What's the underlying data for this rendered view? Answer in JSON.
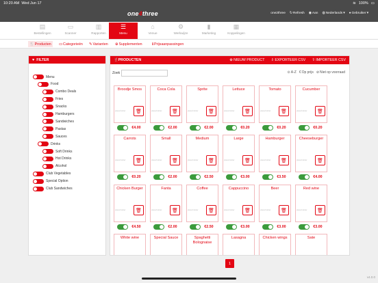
{
  "status": {
    "time": "10:20 AM",
    "date": "Wed Jun 17",
    "battery": "100%"
  },
  "brand": {
    "logo_left": "one",
    "logo_mid": "4",
    "logo_right": "three"
  },
  "header": {
    "user": "one2three",
    "refresh": "Refresh",
    "aan": "Aan",
    "language": "Nederlands",
    "account": "Gebruiker"
  },
  "nav": [
    {
      "label": "Bestellingen",
      "icon": "orders-icon",
      "glyph": "▤"
    },
    {
      "label": "Scanner",
      "icon": "scanner-icon",
      "glyph": "▭"
    },
    {
      "label": "Rapporten",
      "icon": "reports-icon",
      "glyph": "▥"
    },
    {
      "label": "Menu",
      "icon": "menu-icon",
      "glyph": "☰"
    },
    {
      "label": "Venue",
      "icon": "venue-icon",
      "glyph": "⌂"
    },
    {
      "label": "Werkwijze",
      "icon": "gear-icon",
      "glyph": "⚙"
    },
    {
      "label": "Marketing",
      "icon": "marketing-icon",
      "glyph": "▮"
    },
    {
      "label": "Koppelingen",
      "icon": "link-icon",
      "glyph": "▦"
    }
  ],
  "subnav": [
    {
      "label": "Producten",
      "icon": "fork-knife-icon",
      "glyph": "🍴"
    },
    {
      "label": "Categorieën",
      "icon": "folder-icon",
      "glyph": "▭"
    },
    {
      "label": "Varianten",
      "icon": "wrench-icon",
      "glyph": "✎"
    },
    {
      "label": "Supplementen",
      "icon": "plus-circle-icon",
      "glyph": "⊕"
    },
    {
      "label": "Prijsaanpassingen",
      "icon": "info-icon",
      "glyph": "ℹ"
    }
  ],
  "filter": {
    "title": "FILTER",
    "items": [
      {
        "label": "Menu",
        "level": 0
      },
      {
        "label": "Food",
        "level": 1
      },
      {
        "label": "Combo Deals",
        "level": 2
      },
      {
        "label": "Fries",
        "level": 2
      },
      {
        "label": "Snacks",
        "level": 2
      },
      {
        "label": "Hamburgers",
        "level": 2
      },
      {
        "label": "Sandwiches",
        "level": 2
      },
      {
        "label": "Pastas",
        "level": 2
      },
      {
        "label": "Sauces",
        "level": 2
      },
      {
        "label": "Drinks",
        "level": 1
      },
      {
        "label": "Soft Drinks",
        "level": 2
      },
      {
        "label": "Hot Drinks",
        "level": 2
      },
      {
        "label": "Alcohol",
        "level": 2
      },
      {
        "label": "Club Vegetables",
        "level": 0
      },
      {
        "label": "Special Option",
        "level": 0
      },
      {
        "label": "Club Sandwiches",
        "level": 0
      }
    ]
  },
  "products_panel": {
    "title": "PRODUCTEN",
    "new_product": "NIEUW PRODUCT",
    "export": "EXPORTEER CSV",
    "import": "IMPORTEER CSV",
    "search_label": "Zoek",
    "search_value": "",
    "sort_az": "A-Z",
    "sort_price": "Op prijs",
    "sort_stock": "Niet op voorraad"
  },
  "products": [
    {
      "name": "Broodje Smos",
      "price": "€4.00"
    },
    {
      "name": "Coca Cola",
      "price": "€2.00"
    },
    {
      "name": "Sprite",
      "price": "€2.00"
    },
    {
      "name": "Lettuce",
      "price": "€0.20"
    },
    {
      "name": "Tomato",
      "price": "€0.20"
    },
    {
      "name": "Cucumber",
      "price": "€0.20"
    },
    {
      "name": "Carrots",
      "price": "€0.20"
    },
    {
      "name": "Small",
      "price": "€2.00"
    },
    {
      "name": "Medium",
      "price": "€2.50"
    },
    {
      "name": "Large",
      "price": "€3.00"
    },
    {
      "name": "Hamburger",
      "price": "€3.50"
    },
    {
      "name": "Cheeseburger",
      "price": "€4.00"
    },
    {
      "name": "Chicken Burger",
      "price": "€4.50"
    },
    {
      "name": "Fanta",
      "price": "€2.00"
    },
    {
      "name": "Coffee",
      "price": "€2.50"
    },
    {
      "name": "Cappuccino",
      "price": "€3.00"
    },
    {
      "name": "Beer",
      "price": "€3.00"
    },
    {
      "name": "Red wine",
      "price": "€3.00"
    },
    {
      "name": "White wine",
      "price": ""
    },
    {
      "name": "Special Sauce",
      "price": ""
    },
    {
      "name": "Spaghetti Bolognaise",
      "price": ""
    },
    {
      "name": "Lasagna",
      "price": ""
    },
    {
      "name": "Chicken wings",
      "price": ""
    },
    {
      "name": "Sate",
      "price": ""
    }
  ],
  "image_placeholder": "placeholder",
  "pagination": {
    "current": "1"
  },
  "version": "v4.0.0",
  "colors": {
    "accent": "#e30613",
    "toggle_on": "#3c9b3c",
    "bar": "#4a4a4a"
  }
}
